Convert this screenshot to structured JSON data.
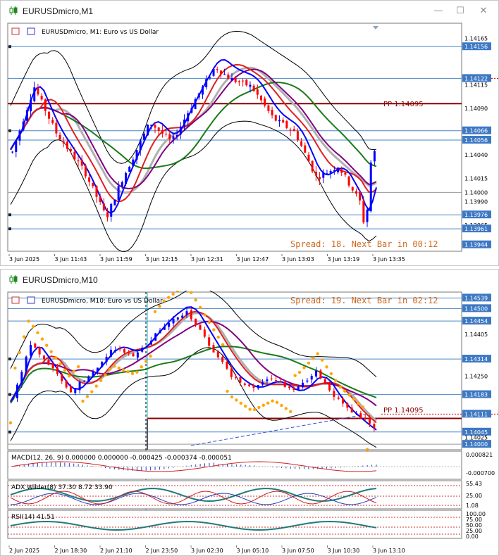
{
  "window1": {
    "title": "EURUSDmicro,M1",
    "header": "EURUSDmicro, M1:  Euro vs US Dollar",
    "spread": "Spread: 18. Next Bar in 00:12",
    "pp_label": "PP 1.14095",
    "price_labels": [
      "1.14165",
      "1.14156",
      "1.14122",
      "1.14115",
      "1.14090",
      "1.14066",
      "1.14056",
      "1.14040",
      "1.14015",
      "1.14000",
      "1.13990",
      "1.13976",
      "1.13965",
      "1.13961",
      "1.13944"
    ],
    "time_labels": [
      "3 Jun 2025",
      "3 Jun 11:43",
      "3 Jun 11:59",
      "3 Jun 12:15",
      "3 Jun 12:31",
      "3 Jun 12:47",
      "3 Jun 13:03",
      "3 Jun 13:19",
      "3 Jun 13:35"
    ]
  },
  "window2": {
    "title": "EURUSDmicro,M10",
    "header": "EURUSDmicro, M10:  Euro vs US Dollar",
    "spread": "Spread: 19. Next Bar in 02:12",
    "pp_label": "PP 1.14095",
    "price_labels": [
      "1.14539",
      "1.14500",
      "1.14454",
      "1.14405",
      "1.14314",
      "1.14250",
      "1.14183",
      "1.14111",
      "1.14045",
      "1.14025",
      "1.14000"
    ],
    "macd_label": "MACD(12, 26, 9) 0.000000 0.000000 -0.000425 -0.000374 -0.000051",
    "macd_scale": [
      "0.000821",
      "-0.000700"
    ],
    "adx_label": "ADX Wilder(8) 37.30 8.72 33.90",
    "adx_scale": [
      "55.43",
      "25.00",
      "1.08"
    ],
    "rsi_label": "RSI(14) 41.51",
    "rsi_scale": [
      "100.00",
      "75.00",
      "50.00",
      "25.00",
      "0.00"
    ],
    "time_labels": [
      "2 Jun 2025",
      "2 Jun 18:30",
      "2 Jun 21:10",
      "2 Jun 23:50",
      "3 Jun 02:30",
      "3 Jun 05:10",
      "3 Jun 07:50",
      "3 Jun 10:30",
      "3 Jun 13:10"
    ]
  },
  "controls": {
    "minimize": "—",
    "maximize": "☐",
    "close": "✕"
  },
  "colors": {
    "up": "#0000ff",
    "down": "#ff0000",
    "hline": "#4a86c8",
    "pp": "#8b0000",
    "spread": "#d2691e",
    "ma_green": "#1a7a1a",
    "ma_red": "#e02020",
    "ma_purple": "#800080",
    "ma_gray": "#b0b0b0",
    "sar": "#ffa500"
  }
}
